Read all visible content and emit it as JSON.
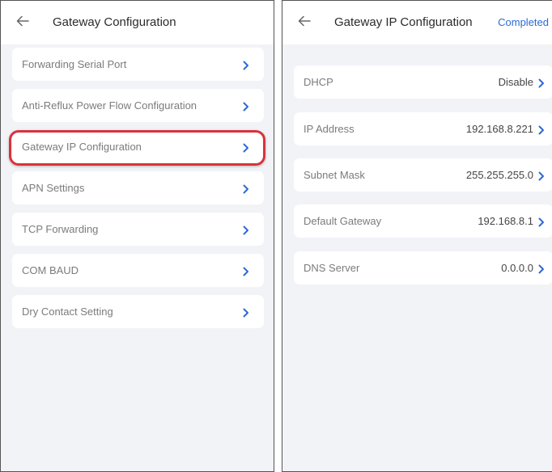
{
  "left": {
    "header": {
      "title": "Gateway Configuration",
      "back_icon": "arrow-left-icon"
    },
    "items": [
      {
        "label": "Forwarding Serial Port"
      },
      {
        "label": "Anti-Reflux Power Flow Configuration"
      },
      {
        "label": "Gateway IP Configuration",
        "highlighted": true
      },
      {
        "label": "APN Settings"
      },
      {
        "label": "TCP Forwarding"
      },
      {
        "label": "COM BAUD"
      },
      {
        "label": "Dry Contact Setting"
      }
    ]
  },
  "right": {
    "header": {
      "title": "Gateway IP Configuration",
      "action": "Completed",
      "back_icon": "arrow-left-icon"
    },
    "fields": [
      {
        "label": "DHCP",
        "value": "Disable"
      },
      {
        "label": "IP Address",
        "value": "192.168.8.221"
      },
      {
        "label": "Subnet Mask",
        "value": "255.255.255.0"
      },
      {
        "label": "Default Gateway",
        "value": "192.168.8.1"
      },
      {
        "label": "DNS Server",
        "value": "0.0.0.0"
      }
    ]
  },
  "colors": {
    "accent": "#2d6ad6",
    "highlight": "#d9323b",
    "background": "#f2f3f7"
  }
}
